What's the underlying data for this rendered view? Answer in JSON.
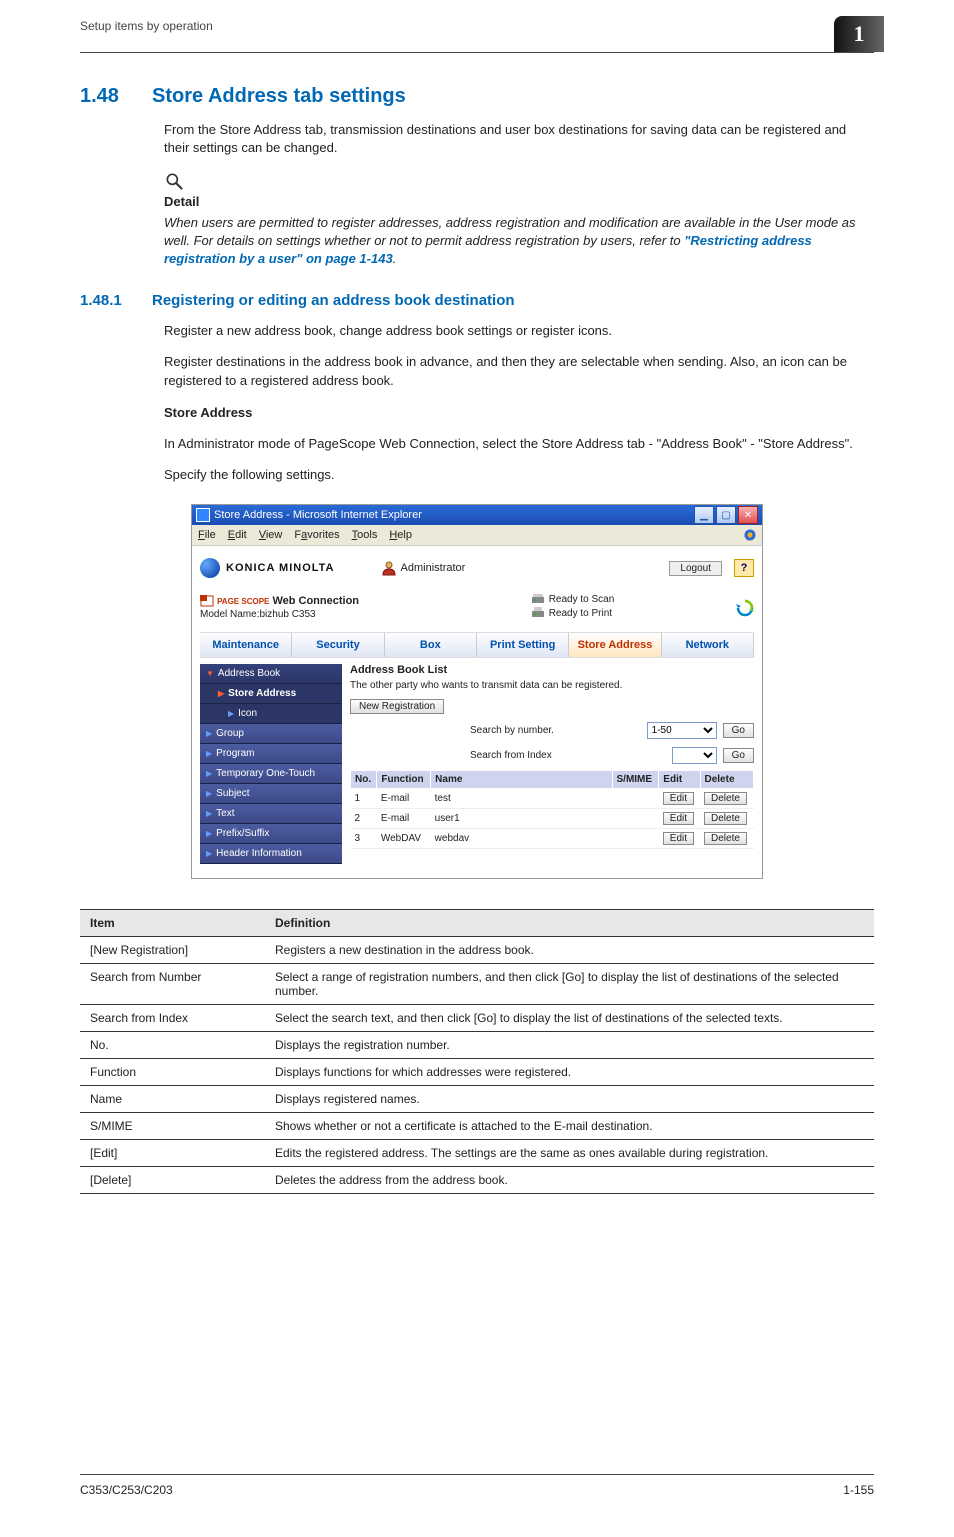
{
  "running_header": "Setup items by operation",
  "chapter_badge": "1",
  "section": {
    "number": "1.48",
    "title": "Store Address tab settings",
    "intro": "From the Store Address tab, transmission destinations and user box destinations for saving data can be registered and their settings can be changed."
  },
  "detail": {
    "label": "Detail",
    "text_pre": "When users are permitted to register addresses, address registration and modification are available in the User mode as well. For details on settings whether or not to permit address registration by users, refer to ",
    "link": "\"Restricting address registration by a user\" on page 1-143",
    "text_post": "."
  },
  "subsection": {
    "number": "1.48.1",
    "title": "Registering or editing an address book destination",
    "p1": "Register a new address book, change address book settings or register icons.",
    "p2": "Register destinations in the address book in advance, and then they are selectable when sending. Also, an icon can be registered to a registered address book.",
    "head": "Store Address",
    "p3": "In Administrator mode of PageScope Web Connection, select the Store Address tab - \"Address Book\" - \"Store Address\".",
    "p4": "Specify the following settings."
  },
  "browser": {
    "title": "Store Address - Microsoft Internet Explorer",
    "menus": [
      "File",
      "Edit",
      "View",
      "Favorites",
      "Tools",
      "Help"
    ],
    "brand": "KONICA MINOLTA",
    "admin_label": "Administrator",
    "logout": "Logout",
    "help": "?",
    "pagescope_html": "Web Connection",
    "pagescope_prefix": "PAGE SCOPE",
    "model": "Model Name:bizhub C353",
    "ready_scan": "Ready to Scan",
    "ready_print": "Ready to Print",
    "tabs": [
      "Maintenance",
      "Security",
      "Box",
      "Print Setting",
      "Store Address",
      "Network"
    ],
    "side": [
      "Address Book",
      "Store Address",
      "Icon",
      "Group",
      "Program",
      "Temporary One-Touch",
      "Subject",
      "Text",
      "Prefix/Suffix",
      "Header Information"
    ],
    "abl_title": "Address Book List",
    "abl_sub": "The other party who wants to transmit data can be registered.",
    "new_reg": "New Registration",
    "search_num_lbl": "Search by number.",
    "search_num_val": "1-50",
    "go": "Go",
    "search_idx_lbl": "Search from Index",
    "cols": [
      "No.",
      "Function",
      "Name",
      "S/MIME",
      "Edit",
      "Delete"
    ],
    "rows": [
      {
        "no": "1",
        "func": "E-mail",
        "name": "test",
        "smime": "",
        "edit": "Edit",
        "del": "Delete"
      },
      {
        "no": "2",
        "func": "E-mail",
        "name": "user1",
        "smime": "",
        "edit": "Edit",
        "del": "Delete"
      },
      {
        "no": "3",
        "func": "WebDAV",
        "name": "webdav",
        "smime": "",
        "edit": "Edit",
        "del": "Delete"
      }
    ]
  },
  "def_headers": {
    "c1": "Item",
    "c2": "Definition"
  },
  "defs": [
    {
      "item": "[New Registration]",
      "def": "Registers a new destination in the address book."
    },
    {
      "item": "Search from Number",
      "def": "Select a range of registration numbers, and then click [Go] to display the list of destinations of the selected number."
    },
    {
      "item": "Search from Index",
      "def": "Select the search text, and then click [Go] to display the list of destinations of the selected texts."
    },
    {
      "item": "No.",
      "def": "Displays the registration number."
    },
    {
      "item": "Function",
      "def": "Displays functions for which addresses were registered."
    },
    {
      "item": "Name",
      "def": "Displays registered names."
    },
    {
      "item": "S/MIME",
      "def": "Shows whether or not a certificate is attached to the E-mail destination."
    },
    {
      "item": "[Edit]",
      "def": "Edits the registered address. The settings are the same as ones available during registration."
    },
    {
      "item": "[Delete]",
      "def": "Deletes the address from the address book."
    }
  ],
  "footer": {
    "left": "C353/C253/C203",
    "right": "1-155"
  }
}
